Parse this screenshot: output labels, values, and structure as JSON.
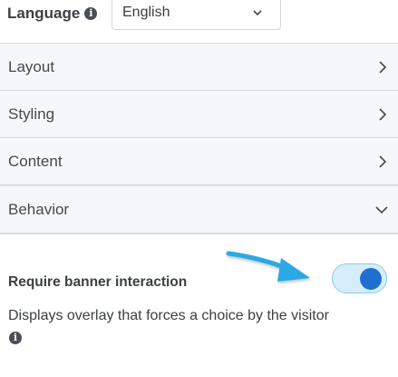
{
  "language": {
    "label": "Language",
    "info_icon": "info-icon",
    "selected": "English"
  },
  "sections": [
    {
      "label": "Layout",
      "state": "collapsed",
      "icon": "chevron-right-icon"
    },
    {
      "label": "Styling",
      "state": "collapsed",
      "icon": "chevron-right-icon"
    },
    {
      "label": "Content",
      "state": "collapsed",
      "icon": "chevron-right-icon"
    },
    {
      "label": "Behavior",
      "state": "expanded",
      "icon": "chevron-down-icon"
    }
  ],
  "behavior": {
    "require_interaction": {
      "label": "Require banner interaction",
      "description": "Displays overlay that forces a choice by the visitor",
      "enabled": true
    }
  },
  "colors": {
    "toggle_on": "#1f6fd1",
    "toggle_track": "#d6eefb",
    "arrow": "#29a9e6",
    "section_bg": "#f6f7f8"
  }
}
